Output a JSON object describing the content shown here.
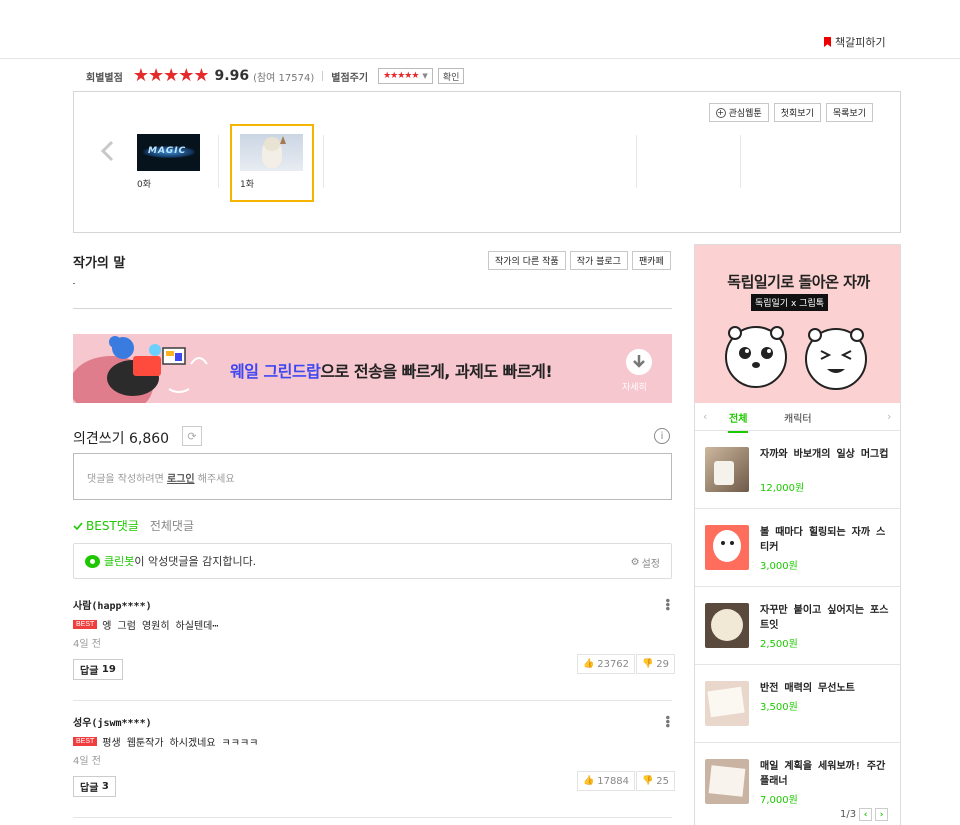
{
  "header": {
    "bookmark_label": "책갈피하기"
  },
  "rating": {
    "label": "회별별점",
    "stars_filled": 5,
    "score": "9.96",
    "count": "(참여 17574)",
    "give_label": "별점주기",
    "confirm_label": "확인"
  },
  "episodes": {
    "buttons": {
      "interest": "관심웹툰",
      "first": "첫회보기",
      "list": "목록보기"
    },
    "items": [
      {
        "label": "0화",
        "thumb_text": "MAGIC"
      },
      {
        "label": "1화"
      }
    ]
  },
  "author": {
    "title": "작가의 말",
    "buttons": {
      "other_works": "작가의 다른 작품",
      "blog": "작가 블로그",
      "fancafe": "팬카페"
    }
  },
  "banner": {
    "text_highlight": "웨일 그린드랍",
    "text_rest": "으로 전송을 빠르게, 과제도 빠르게!",
    "download_label": "자세히"
  },
  "comments": {
    "title": "의견쓰기",
    "count": "6,860",
    "input": {
      "placeholder_pre": "댓글을 작성하려면 ",
      "login": "로그인",
      "placeholder_post": " 해주세요"
    },
    "tabs": {
      "best": "BEST댓글",
      "all": "전체댓글"
    },
    "cleanbot": {
      "name": "클린봇",
      "text": "이 악성댓글을 감지합니다.",
      "setting": "설정"
    },
    "items": [
      {
        "user": "사람(happ****)",
        "badge": "BEST",
        "text": "엥 그럼 영원히 하실텐데⋯",
        "date": "4일 전",
        "reply_label": "답글",
        "reply_count": "19",
        "likes": "23762",
        "dislikes": "29"
      },
      {
        "user": "성우(jswm****)",
        "badge": "BEST",
        "text": "평생 웹툰작가 하시겠네요 ㅋㅋㅋㅋ",
        "date": "4일 전",
        "reply_label": "답글",
        "reply_count": "3",
        "likes": "17884",
        "dislikes": "25"
      }
    ]
  },
  "sidebar": {
    "title": "독립일기로 돌아온 자까",
    "subtitle": "독립일기 x 그립톡",
    "tabs": {
      "all": "전체",
      "character": "캐릭터"
    },
    "products": [
      {
        "name": "자까와 바보개의 일상 머그컵",
        "price": "12,000원"
      },
      {
        "name": "볼 때마다 힐링되는 자까 스티커",
        "price": "3,000원"
      },
      {
        "name": "자꾸만 붙이고 싶어지는 포스트잇",
        "price": "2,500원"
      },
      {
        "name": "반전 매력의 무선노트",
        "price": "3,500원"
      },
      {
        "name": "매일 계획을 세워보까! 주간플래너",
        "price": "7,000원"
      }
    ],
    "pager": "1/3"
  },
  "colors": {
    "accent_green": "#1ec800",
    "star_red": "#e42a2a",
    "selected_border": "#f5b400",
    "banner_bg": "#f6c7ce",
    "side_hero_bg": "#fcd1d1"
  }
}
